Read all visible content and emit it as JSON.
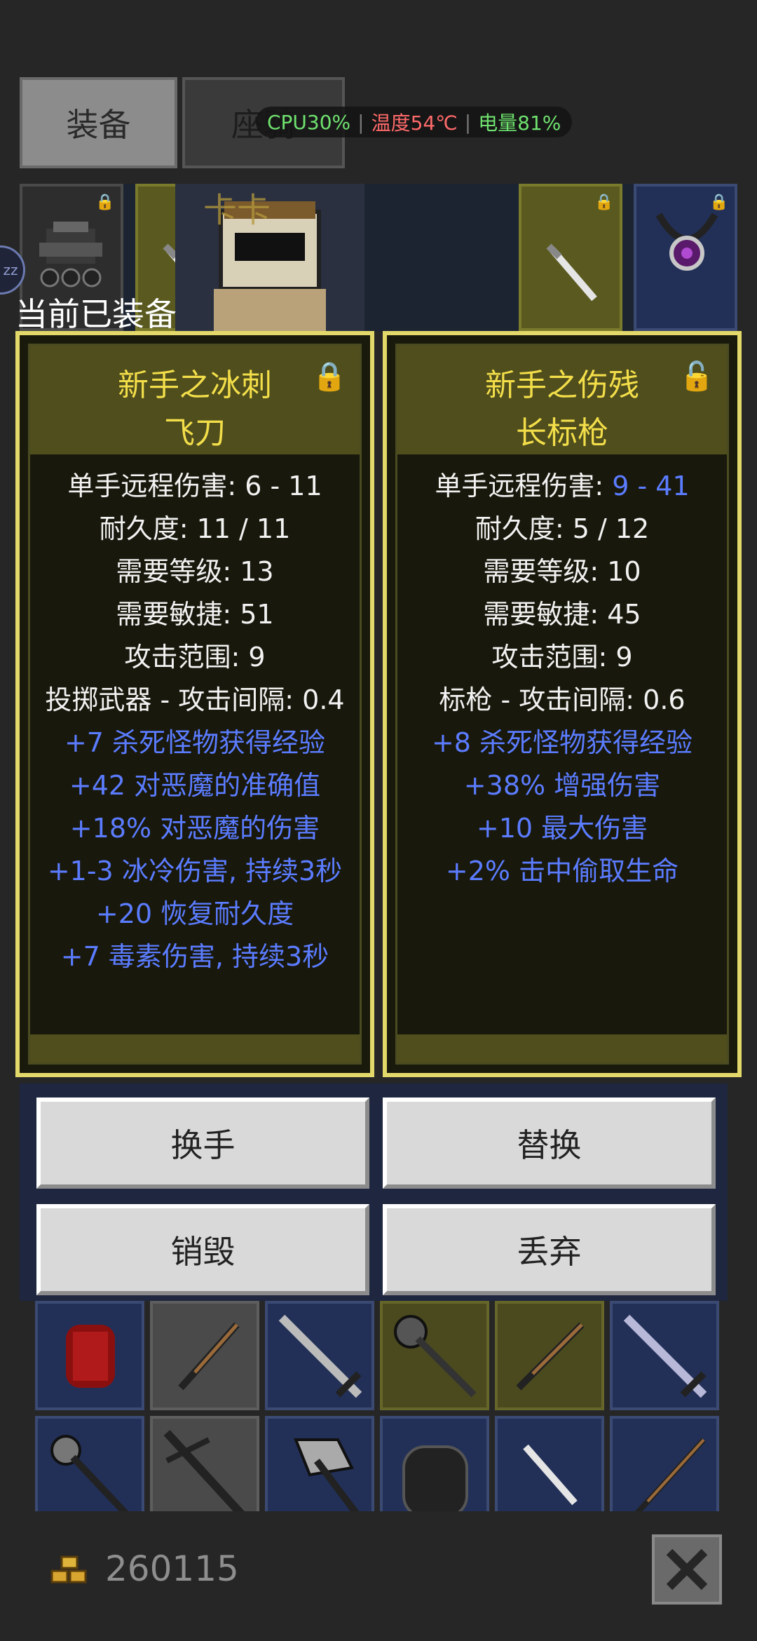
{
  "tabs": {
    "equip": "装备",
    "mount": "座骑"
  },
  "status": {
    "cpu": "CPU30%",
    "temp": "温度54℃",
    "battery": "电量81%"
  },
  "strip_text": "卡卡",
  "side_label": "zz",
  "current_label": "当前已装备",
  "left_item": {
    "title1": "新手之冰刺",
    "title2": "飞刀",
    "lines": [
      {
        "text": "单手远程伤害: 6 - 11",
        "color": "white"
      },
      {
        "text": "耐久度: 11 / 11",
        "color": "white"
      },
      {
        "text": "需要等级: 13",
        "color": "white"
      },
      {
        "text": "需要敏捷: 51",
        "color": "white"
      },
      {
        "text": "攻击范围: 9",
        "color": "white"
      },
      {
        "text": "投掷武器 - 攻击间隔: 0.4",
        "color": "white"
      },
      {
        "text": "+7 杀死怪物获得经验",
        "color": "blue"
      },
      {
        "text": "+42 对恶魔的准确值",
        "color": "blue"
      },
      {
        "text": "+18% 对恶魔的伤害",
        "color": "blue"
      },
      {
        "text": "+1-3 冰冷伤害, 持续3秒",
        "color": "blue"
      },
      {
        "text": "+20 恢复耐久度",
        "color": "blue"
      },
      {
        "text": "+7 毒素伤害, 持续3秒",
        "color": "blue"
      }
    ]
  },
  "right_item": {
    "title1": "新手之伤残",
    "title2": "长标枪",
    "damage_label": "单手远程伤害: ",
    "damage_value": "9 - 41",
    "lines": [
      {
        "text": "耐久度: 5 / 12",
        "color": "white"
      },
      {
        "text": "需要等级: 10",
        "color": "white"
      },
      {
        "text": "需要敏捷: 45",
        "color": "white"
      },
      {
        "text": "攻击范围: 9",
        "color": "white"
      },
      {
        "text": "标枪 - 攻击间隔: 0.6",
        "color": "white"
      },
      {
        "text": "+8 杀死怪物获得经验",
        "color": "blue"
      },
      {
        "text": "+38% 增强伤害",
        "color": "blue"
      },
      {
        "text": "+10 最大伤害",
        "color": "blue"
      },
      {
        "text": "+2% 击中偷取生命",
        "color": "blue"
      }
    ]
  },
  "buttons": {
    "swap_hand": "换手",
    "replace": "替换",
    "destroy": "销毁",
    "discard": "丢弃"
  },
  "gold": "260115",
  "colors": {
    "gold_title": "#f3de4a",
    "magic_blue": "#5b7cff",
    "card_border": "#e3d96a"
  }
}
